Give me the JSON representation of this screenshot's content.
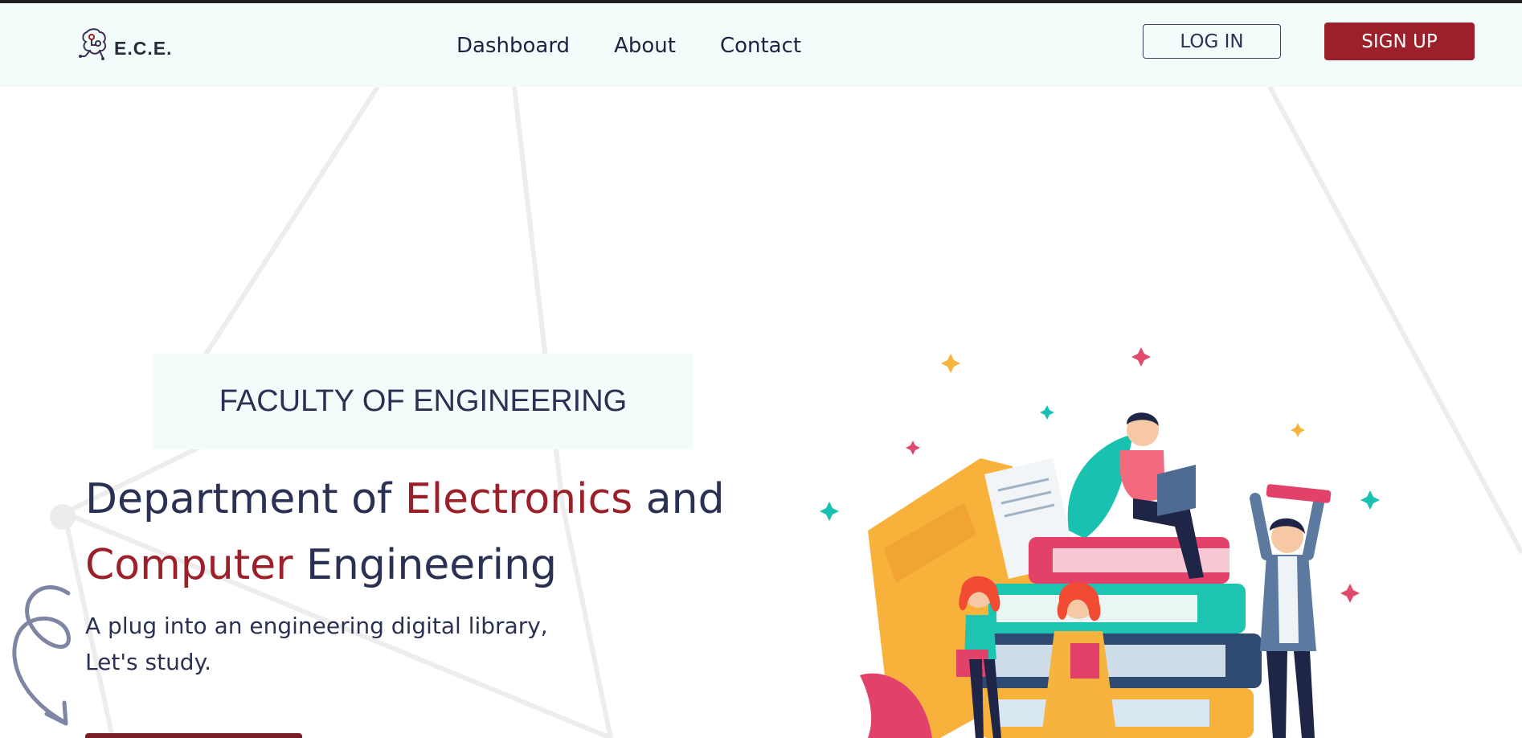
{
  "header": {
    "logo_text": "E.C.E.",
    "nav": [
      "Dashboard",
      "About",
      "Contact"
    ],
    "login_label": "LOG IN",
    "signup_label": "SIGN UP"
  },
  "hero": {
    "faculty": "FACULTY OF ENGINEERING",
    "title_part1": "Department of ",
    "title_accent1": "Electronics",
    "title_part2": " and",
    "title_accent2": "Computer",
    "title_part3": " Engineering",
    "subtitle_line1": "A plug into an engineering digital library,",
    "subtitle_line2": "Let's study."
  },
  "colors": {
    "accent": "#9c2029",
    "navy": "#2b3152",
    "nav_bg": "#f2fcfa"
  },
  "icons": {
    "logo": "circuit-brain-icon",
    "decoration": "swirl-arrow-icon",
    "illustration": "students-reading-books-illustration"
  }
}
